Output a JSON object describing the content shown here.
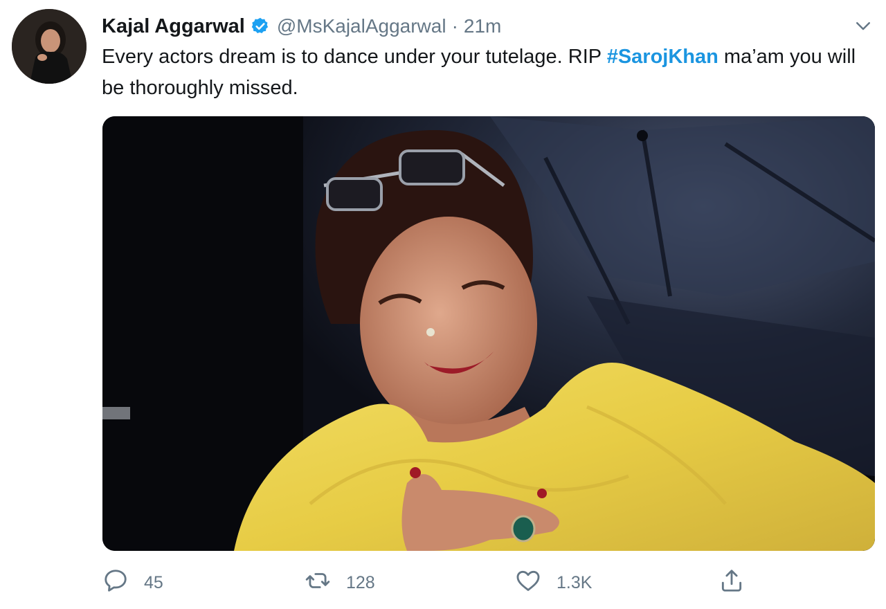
{
  "tweet": {
    "author_name": "Kajal Aggarwal",
    "handle": "@MsKajalAggarwal",
    "separator": "·",
    "time": "21m",
    "text_before": "Every actors dream is to dance under your tutelage. RIP ",
    "hashtag": "#SarojKhan",
    "text_after": " ma’am you will be thoroughly missed."
  },
  "actions": {
    "replies": "45",
    "retweets": "128",
    "likes": "1.3K"
  },
  "icons": {
    "verified": "verified-badge-icon",
    "menu": "chevron-down-icon",
    "reply": "reply-icon",
    "retweet": "retweet-icon",
    "like": "heart-icon",
    "share": "share-icon"
  },
  "colors": {
    "link": "#1b95e0",
    "secondary_text": "#657786",
    "primary_text": "#14171a",
    "verified": "#1da1f2"
  }
}
